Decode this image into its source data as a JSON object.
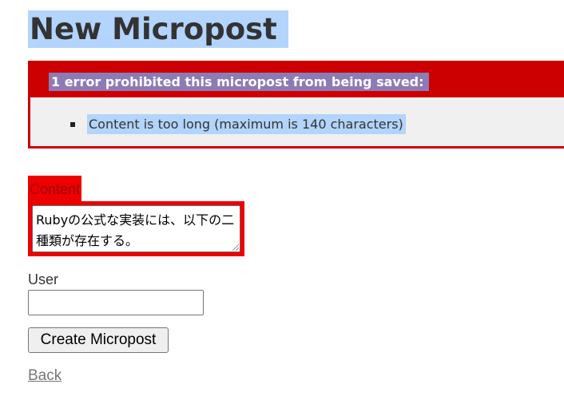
{
  "page": {
    "title": "New Micropost"
  },
  "error_explanation": {
    "header": "1 error prohibited this micropost from being saved:",
    "messages": [
      "Content is too long (maximum is 140 characters)"
    ]
  },
  "form": {
    "content_label": "Content",
    "content_value": "Rubyの公式な実装には、以下の二種類が存在する。",
    "user_label": "User",
    "user_value": "",
    "submit_label": "Create Micropost"
  },
  "nav": {
    "back_label": "Back"
  },
  "colors": {
    "error_red": "#cc0000",
    "field_error_red": "#ee0000",
    "selection_blue": "#b3d4fc",
    "error_header_highlight": "#8c7bb5",
    "error_box_bg": "#f0f0f0"
  }
}
